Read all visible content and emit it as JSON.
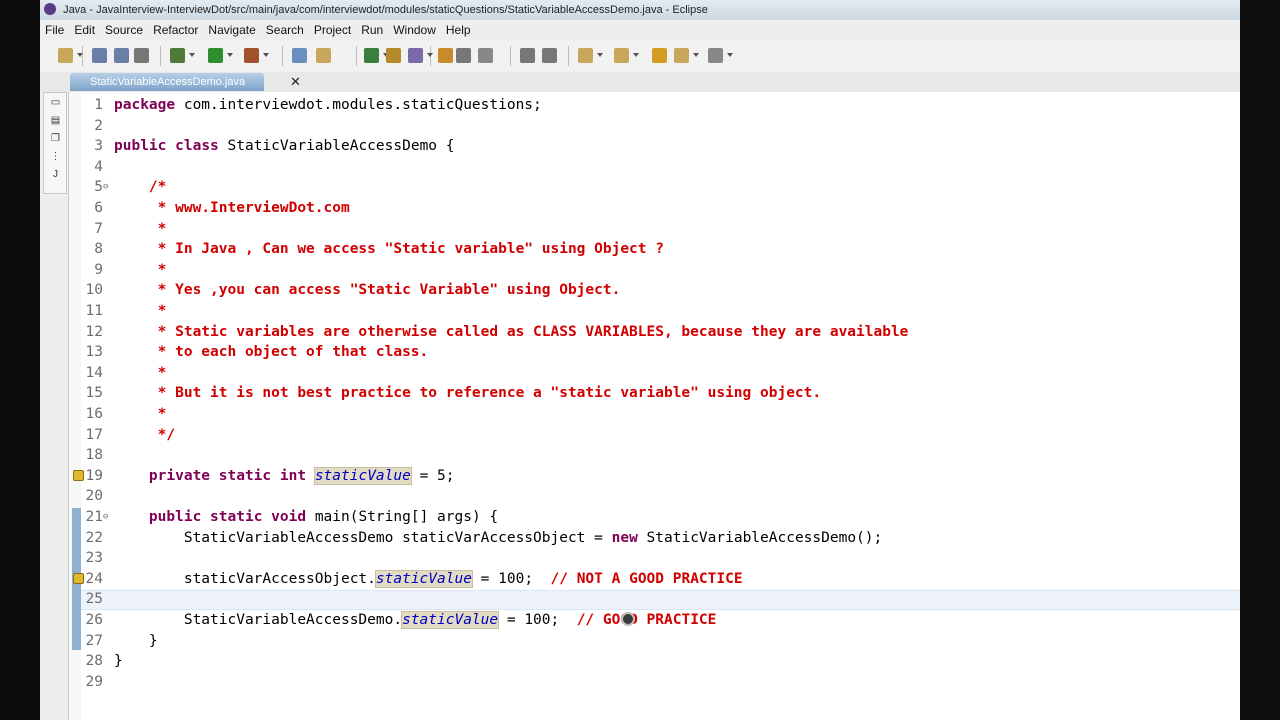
{
  "window": {
    "title": "Java - JavaInterview-InterviewDot/src/main/java/com/interviewdot/modules/staticQuestions/StaticVariableAccessDemo.java - Eclipse"
  },
  "menubar": [
    "File",
    "Edit",
    "Source",
    "Refactor",
    "Navigate",
    "Search",
    "Project",
    "Run",
    "Window",
    "Help"
  ],
  "toolbar_icons": [
    "new-icon",
    "save-icon",
    "save-all-icon",
    "print-icon",
    "debug-icon",
    "run-icon",
    "external-tools-icon",
    "new-java-project-icon",
    "new-package-icon",
    "new-class-icon",
    "open-type-icon",
    "search-icon",
    "refactor-icon",
    "toggle-mark-occurrences-icon",
    "toggle-breadcrumb-icon",
    "show-whitespace-icon",
    "block-selection-icon",
    "next-annotation-icon",
    "previous-annotation-icon",
    "last-edit-icon",
    "back-icon",
    "forward-icon"
  ],
  "editor": {
    "tab": {
      "label": "StaticVariableAccessDemo.java",
      "close": "✕"
    },
    "lines": [
      {
        "n": "1",
        "html": "<span class=\"kw\">package</span> com.interviewdot.modules.staticQuestions;"
      },
      {
        "n": "2",
        "html": ""
      },
      {
        "n": "3",
        "html": "<span class=\"kw\">public</span> <span class=\"kw\">class</span> StaticVariableAccessDemo {"
      },
      {
        "n": "4",
        "html": ""
      },
      {
        "n": "5",
        "fold": "⊖",
        "html": "    <span class=\"cm\">/*</span>"
      },
      {
        "n": "6",
        "html": "<span class=\"cm\">     * www.InterviewDot.com</span>"
      },
      {
        "n": "7",
        "html": "<span class=\"cm\">     *</span>"
      },
      {
        "n": "8",
        "html": "<span class=\"cm\">     * In Java , Can we access \"Static variable\" using Object ?</span>"
      },
      {
        "n": "9",
        "html": "<span class=\"cm\">     *</span>"
      },
      {
        "n": "10",
        "html": "<span class=\"cm\">     * Yes ,you can access \"Static Variable\" using Object.</span>"
      },
      {
        "n": "11",
        "html": "<span class=\"cm\">     *</span>"
      },
      {
        "n": "12",
        "html": "<span class=\"cm\">     * Static variables are otherwise called as CLASS VARIABLES, because they are available</span>"
      },
      {
        "n": "13",
        "html": "<span class=\"cm\">     * to each object of that class.</span>"
      },
      {
        "n": "14",
        "html": "<span class=\"cm\">     *</span>"
      },
      {
        "n": "15",
        "html": "<span class=\"cm\">     * But it is not best practice to reference a \"static variable\" using object.</span>"
      },
      {
        "n": "16",
        "html": "<span class=\"cm\">     *</span>"
      },
      {
        "n": "17",
        "html": "<span class=\"cm\">     */</span>"
      },
      {
        "n": "18",
        "html": ""
      },
      {
        "n": "19",
        "warn": true,
        "html": "    <span class=\"kw\">private</span> <span class=\"kw\">static</span> <span class=\"kw\">int</span> <span class=\"sf\">staticValue</span> = 5;"
      },
      {
        "n": "20",
        "html": ""
      },
      {
        "n": "21",
        "fold": "⊖",
        "html": "    <span class=\"kw\">public</span> <span class=\"kw\">static</span> <span class=\"kw\">void</span> main(String[] args) {"
      },
      {
        "n": "22",
        "html": "        StaticVariableAccessDemo staticVarAccessObject = <span class=\"kw\">new</span> StaticVariableAccessDemo();"
      },
      {
        "n": "23",
        "html": ""
      },
      {
        "n": "24",
        "warn": true,
        "html": "        staticVarAccessObject.<span class=\"sf\">staticValue</span> = 100;  <span class=\"cm\">// NOT A GOOD PRACTICE</span>"
      },
      {
        "n": "25",
        "html": ""
      },
      {
        "n": "26",
        "html": "        StaticVariableAccessDemo.<span class=\"sf\">staticValue</span> = 100;  <span class=\"cm\">// GOOD PRACTICE</span>"
      },
      {
        "n": "27",
        "html": "    }"
      },
      {
        "n": "28",
        "html": "}"
      },
      {
        "n": "29",
        "html": ""
      }
    ]
  }
}
